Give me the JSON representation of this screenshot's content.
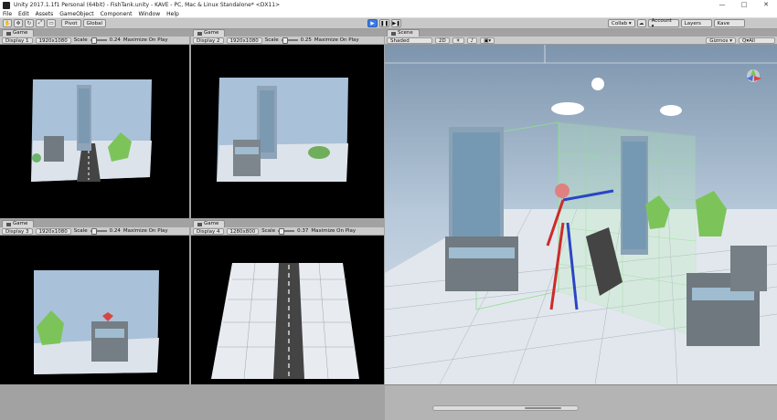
{
  "window": {
    "title": "Unity 2017.1.1f1 Personal (64bit) - FishTank.unity - KAVE - PC, Mac & Linux Standalone* <DX11>",
    "controls": [
      "—",
      "□",
      "✕"
    ]
  },
  "menu": [
    "File",
    "Edit",
    "Assets",
    "GameObject",
    "Component",
    "Window",
    "Help"
  ],
  "toolbar": {
    "pivot": "Pivot",
    "global": "Global",
    "collab": "Collab ▾",
    "account": "Account ▾",
    "layers": "Layers",
    "layout": "Kave"
  },
  "game_views": [
    {
      "tab": "Game",
      "display": "Display 1",
      "resolution": "1920x1080",
      "scale_label": "Scale",
      "scale_value": "0.24",
      "maximize": "Maximize On Play"
    },
    {
      "tab": "Game",
      "display": "Display 2",
      "resolution": "1920x1080",
      "scale_label": "Scale",
      "scale_value": "0.25",
      "maximize": "Maximize On Play"
    },
    {
      "tab": "Game",
      "display": "Display 3",
      "resolution": "1920x1080",
      "scale_label": "Scale",
      "scale_value": "0.24",
      "maximize": "Maximize On Play"
    },
    {
      "tab": "Game",
      "display": "Display 4",
      "resolution": "1280x800",
      "scale_label": "Scale",
      "scale_value": "0.37",
      "maximize": "Maximize On Play"
    }
  ],
  "scene": {
    "tab": "Scene",
    "shading": "Shaded",
    "mode_2d": "2D",
    "gizmos": "Gizmos ▾",
    "search": "Q▾All"
  },
  "colors": {
    "sky": "#a9c1d9",
    "ground": "#d4dbe3",
    "grid_green": "#7fd47f",
    "play_blue": "#3b7be8"
  }
}
